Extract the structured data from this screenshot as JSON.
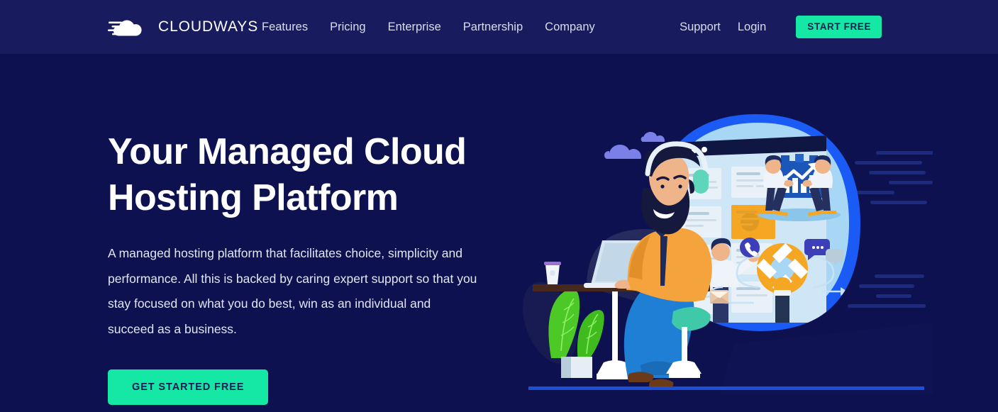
{
  "page": {
    "background_color": "#0e1150",
    "accent_color": "#14e8a4"
  },
  "header": {
    "background_color": "#181c5e",
    "brand": {
      "name": "CLOUDWAYS",
      "logo_icon": "cloud-speed-icon"
    },
    "nav": [
      {
        "label": "Features"
      },
      {
        "label": "Pricing"
      },
      {
        "label": "Enterprise"
      },
      {
        "label": "Partnership"
      },
      {
        "label": "Company"
      }
    ],
    "support_label": "Support",
    "login_label": "Login",
    "cta_label": "START FREE"
  },
  "hero": {
    "title": "Your Managed Cloud\nHosting Platform",
    "subtitle": "A managed hosting platform that facilitates choice, simplicity and performance. All this is backed by caring expert support so that you stay focused on what you do best, win as an individual and succeed as a business.",
    "cta_label": "GET STARTED FREE",
    "illustration": {
      "alt": "Support agent with headphones at a desk with laptop, thought bubble showing a browser dashboard, two people carrying a growth chart, and customer-support icons",
      "colors": {
        "bubble_outer": "#1a5bf5",
        "bubble_inner": "#a8d6f5",
        "jacket": "#f5a33c",
        "jeans": "#1f7fd4",
        "headphones": "#5ed6bb",
        "plant": "#4cc926",
        "ground_line": "#1a4fd6",
        "cloud": "#7b7fe8",
        "highlight_card": "#f5a623"
      }
    }
  }
}
